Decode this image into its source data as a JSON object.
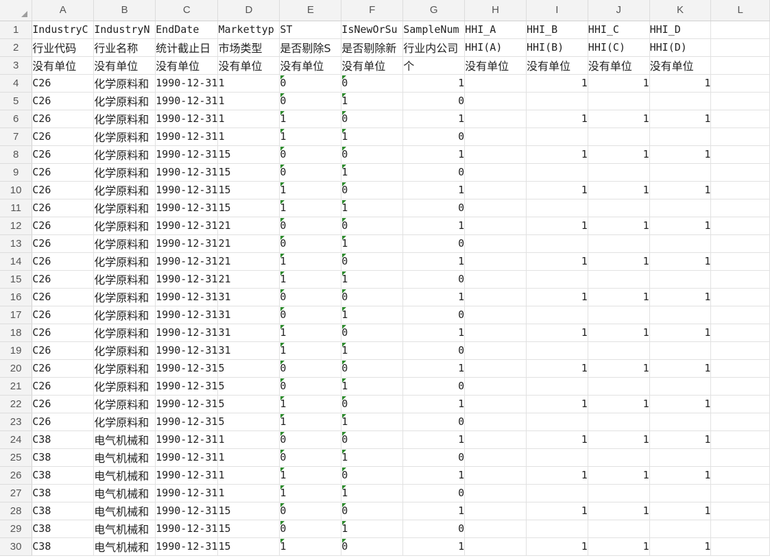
{
  "columns": [
    "A",
    "B",
    "C",
    "D",
    "E",
    "F",
    "G",
    "H",
    "I",
    "J",
    "K",
    "L"
  ],
  "header_rows": [
    {
      "row": "1",
      "cells": [
        "IndustryC",
        "IndustryN",
        "EndDate",
        "Markettyp",
        "ST",
        "IsNewOrSu",
        "SampleNum",
        "HHI_A",
        "HHI_B",
        "HHI_C",
        "HHI_D",
        ""
      ]
    },
    {
      "row": "2",
      "cells": [
        "行业代码",
        "行业名称",
        "统计截止日",
        "市场类型",
        "是否剔除S",
        "是否剔除新",
        "行业内公司",
        "HHI(A)",
        "HHI(B)",
        "HHI(C)",
        "HHI(D)",
        ""
      ]
    },
    {
      "row": "3",
      "cells": [
        "没有单位",
        "没有单位",
        "没有单位",
        "没有单位",
        "没有单位",
        "没有单位",
        "个",
        "没有单位",
        "没有单位",
        "没有单位",
        "没有单位",
        ""
      ]
    }
  ],
  "data_rows": [
    {
      "row": "4",
      "code": "C26",
      "name": "化学原料和",
      "date": "1990-12-31",
      "market": "1",
      "st": "0",
      "isnew": "0",
      "samplenum": "1",
      "hhi_a": "",
      "hhi_b": "1",
      "hhi_c": "1",
      "hhi_d": "1"
    },
    {
      "row": "5",
      "code": "C26",
      "name": "化学原料和",
      "date": "1990-12-31",
      "market": "1",
      "st": "0",
      "isnew": "1",
      "samplenum": "0",
      "hhi_a": "",
      "hhi_b": "",
      "hhi_c": "",
      "hhi_d": ""
    },
    {
      "row": "6",
      "code": "C26",
      "name": "化学原料和",
      "date": "1990-12-31",
      "market": "1",
      "st": "1",
      "isnew": "0",
      "samplenum": "1",
      "hhi_a": "",
      "hhi_b": "1",
      "hhi_c": "1",
      "hhi_d": "1"
    },
    {
      "row": "7",
      "code": "C26",
      "name": "化学原料和",
      "date": "1990-12-31",
      "market": "1",
      "st": "1",
      "isnew": "1",
      "samplenum": "0",
      "hhi_a": "",
      "hhi_b": "",
      "hhi_c": "",
      "hhi_d": ""
    },
    {
      "row": "8",
      "code": "C26",
      "name": "化学原料和",
      "date": "1990-12-31",
      "market": "15",
      "st": "0",
      "isnew": "0",
      "samplenum": "1",
      "hhi_a": "",
      "hhi_b": "1",
      "hhi_c": "1",
      "hhi_d": "1"
    },
    {
      "row": "9",
      "code": "C26",
      "name": "化学原料和",
      "date": "1990-12-31",
      "market": "15",
      "st": "0",
      "isnew": "1",
      "samplenum": "0",
      "hhi_a": "",
      "hhi_b": "",
      "hhi_c": "",
      "hhi_d": ""
    },
    {
      "row": "10",
      "code": "C26",
      "name": "化学原料和",
      "date": "1990-12-31",
      "market": "15",
      "st": "1",
      "isnew": "0",
      "samplenum": "1",
      "hhi_a": "",
      "hhi_b": "1",
      "hhi_c": "1",
      "hhi_d": "1"
    },
    {
      "row": "11",
      "code": "C26",
      "name": "化学原料和",
      "date": "1990-12-31",
      "market": "15",
      "st": "1",
      "isnew": "1",
      "samplenum": "0",
      "hhi_a": "",
      "hhi_b": "",
      "hhi_c": "",
      "hhi_d": ""
    },
    {
      "row": "12",
      "code": "C26",
      "name": "化学原料和",
      "date": "1990-12-31",
      "market": "21",
      "st": "0",
      "isnew": "0",
      "samplenum": "1",
      "hhi_a": "",
      "hhi_b": "1",
      "hhi_c": "1",
      "hhi_d": "1"
    },
    {
      "row": "13",
      "code": "C26",
      "name": "化学原料和",
      "date": "1990-12-31",
      "market": "21",
      "st": "0",
      "isnew": "1",
      "samplenum": "0",
      "hhi_a": "",
      "hhi_b": "",
      "hhi_c": "",
      "hhi_d": ""
    },
    {
      "row": "14",
      "code": "C26",
      "name": "化学原料和",
      "date": "1990-12-31",
      "market": "21",
      "st": "1",
      "isnew": "0",
      "samplenum": "1",
      "hhi_a": "",
      "hhi_b": "1",
      "hhi_c": "1",
      "hhi_d": "1"
    },
    {
      "row": "15",
      "code": "C26",
      "name": "化学原料和",
      "date": "1990-12-31",
      "market": "21",
      "st": "1",
      "isnew": "1",
      "samplenum": "0",
      "hhi_a": "",
      "hhi_b": "",
      "hhi_c": "",
      "hhi_d": ""
    },
    {
      "row": "16",
      "code": "C26",
      "name": "化学原料和",
      "date": "1990-12-31",
      "market": "31",
      "st": "0",
      "isnew": "0",
      "samplenum": "1",
      "hhi_a": "",
      "hhi_b": "1",
      "hhi_c": "1",
      "hhi_d": "1"
    },
    {
      "row": "17",
      "code": "C26",
      "name": "化学原料和",
      "date": "1990-12-31",
      "market": "31",
      "st": "0",
      "isnew": "1",
      "samplenum": "0",
      "hhi_a": "",
      "hhi_b": "",
      "hhi_c": "",
      "hhi_d": ""
    },
    {
      "row": "18",
      "code": "C26",
      "name": "化学原料和",
      "date": "1990-12-31",
      "market": "31",
      "st": "1",
      "isnew": "0",
      "samplenum": "1",
      "hhi_a": "",
      "hhi_b": "1",
      "hhi_c": "1",
      "hhi_d": "1"
    },
    {
      "row": "19",
      "code": "C26",
      "name": "化学原料和",
      "date": "1990-12-31",
      "market": "31",
      "st": "1",
      "isnew": "1",
      "samplenum": "0",
      "hhi_a": "",
      "hhi_b": "",
      "hhi_c": "",
      "hhi_d": ""
    },
    {
      "row": "20",
      "code": "C26",
      "name": "化学原料和",
      "date": "1990-12-31",
      "market": "5",
      "st": "0",
      "isnew": "0",
      "samplenum": "1",
      "hhi_a": "",
      "hhi_b": "1",
      "hhi_c": "1",
      "hhi_d": "1"
    },
    {
      "row": "21",
      "code": "C26",
      "name": "化学原料和",
      "date": "1990-12-31",
      "market": "5",
      "st": "0",
      "isnew": "1",
      "samplenum": "0",
      "hhi_a": "",
      "hhi_b": "",
      "hhi_c": "",
      "hhi_d": ""
    },
    {
      "row": "22",
      "code": "C26",
      "name": "化学原料和",
      "date": "1990-12-31",
      "market": "5",
      "st": "1",
      "isnew": "0",
      "samplenum": "1",
      "hhi_a": "",
      "hhi_b": "1",
      "hhi_c": "1",
      "hhi_d": "1"
    },
    {
      "row": "23",
      "code": "C26",
      "name": "化学原料和",
      "date": "1990-12-31",
      "market": "5",
      "st": "1",
      "isnew": "1",
      "samplenum": "0",
      "hhi_a": "",
      "hhi_b": "",
      "hhi_c": "",
      "hhi_d": ""
    },
    {
      "row": "24",
      "code": "C38",
      "name": "电气机械和",
      "date": "1990-12-31",
      "market": "1",
      "st": "0",
      "isnew": "0",
      "samplenum": "1",
      "hhi_a": "",
      "hhi_b": "1",
      "hhi_c": "1",
      "hhi_d": "1"
    },
    {
      "row": "25",
      "code": "C38",
      "name": "电气机械和",
      "date": "1990-12-31",
      "market": "1",
      "st": "0",
      "isnew": "1",
      "samplenum": "0",
      "hhi_a": "",
      "hhi_b": "",
      "hhi_c": "",
      "hhi_d": ""
    },
    {
      "row": "26",
      "code": "C38",
      "name": "电气机械和",
      "date": "1990-12-31",
      "market": "1",
      "st": "1",
      "isnew": "0",
      "samplenum": "1",
      "hhi_a": "",
      "hhi_b": "1",
      "hhi_c": "1",
      "hhi_d": "1"
    },
    {
      "row": "27",
      "code": "C38",
      "name": "电气机械和",
      "date": "1990-12-31",
      "market": "1",
      "st": "1",
      "isnew": "1",
      "samplenum": "0",
      "hhi_a": "",
      "hhi_b": "",
      "hhi_c": "",
      "hhi_d": ""
    },
    {
      "row": "28",
      "code": "C38",
      "name": "电气机械和",
      "date": "1990-12-31",
      "market": "15",
      "st": "0",
      "isnew": "0",
      "samplenum": "1",
      "hhi_a": "",
      "hhi_b": "1",
      "hhi_c": "1",
      "hhi_d": "1"
    },
    {
      "row": "29",
      "code": "C38",
      "name": "电气机械和",
      "date": "1990-12-31",
      "market": "15",
      "st": "0",
      "isnew": "1",
      "samplenum": "0",
      "hhi_a": "",
      "hhi_b": "",
      "hhi_c": "",
      "hhi_d": ""
    },
    {
      "row": "30",
      "code": "C38",
      "name": "电气机械和",
      "date": "1990-12-31",
      "market": "15",
      "st": "1",
      "isnew": "0",
      "samplenum": "1",
      "hhi_a": "",
      "hhi_b": "1",
      "hhi_c": "1",
      "hhi_d": "1"
    }
  ]
}
